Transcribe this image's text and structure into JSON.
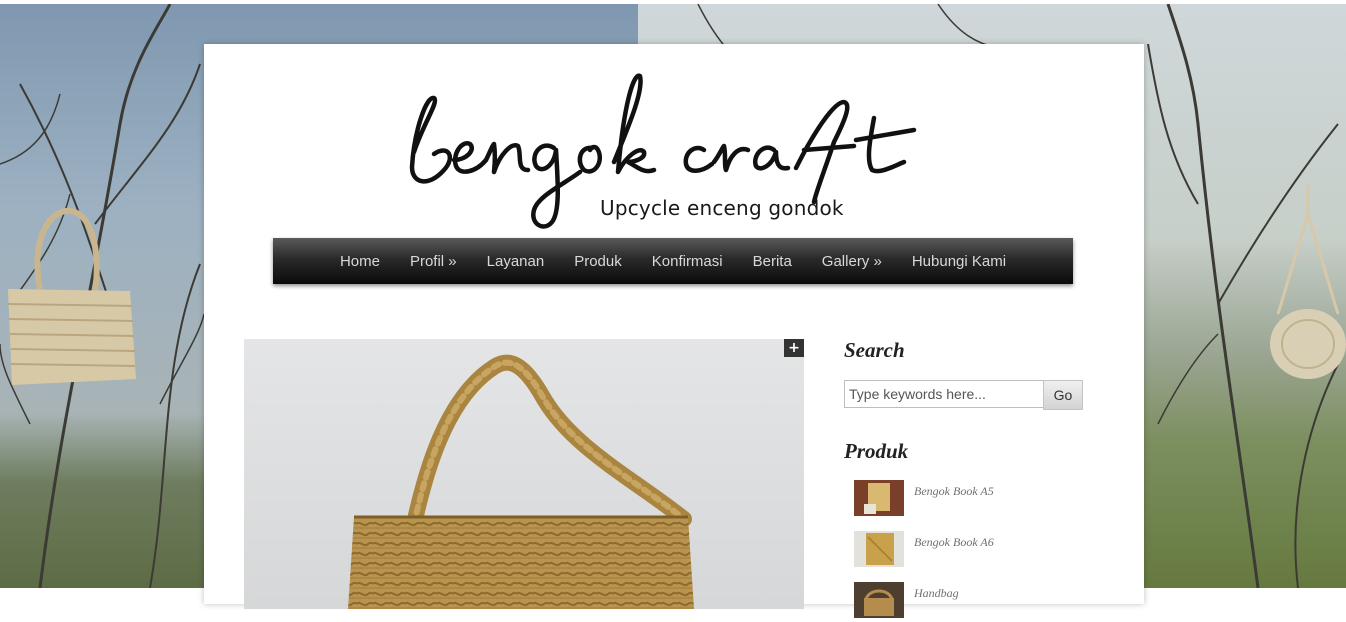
{
  "logo": {
    "script_text": "bengok craft",
    "tagline": "Upcycle enceng gondok"
  },
  "nav": {
    "items": [
      {
        "label": "Home"
      },
      {
        "label": "Profil »"
      },
      {
        "label": "Layanan"
      },
      {
        "label": "Produk"
      },
      {
        "label": "Konfirmasi"
      },
      {
        "label": "Berita"
      },
      {
        "label": "Gallery »"
      },
      {
        "label": "Hubungi Kami"
      }
    ]
  },
  "main": {
    "image_icon": "handbag-photo",
    "expand_label": "+"
  },
  "sidebar": {
    "search": {
      "title": "Search",
      "placeholder": "Type keywords here...",
      "button_label": "Go"
    },
    "produk": {
      "title": "Produk",
      "items": [
        {
          "name": "Bengok Book A5",
          "thumb_color": "#8a4a2e"
        },
        {
          "name": "Bengok Book A6",
          "thumb_color": "#c9a44a"
        },
        {
          "name": "Handbag",
          "thumb_color": "#6b5a44"
        }
      ]
    }
  },
  "colors": {
    "nav_bg": "#1a1a1a",
    "nav_text": "#d8d8d8",
    "page_bg": "#ffffff"
  }
}
